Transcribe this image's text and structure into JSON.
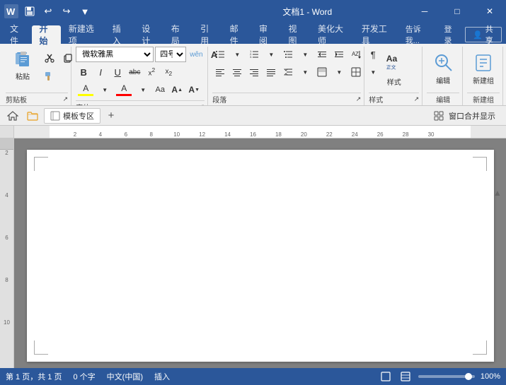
{
  "titlebar": {
    "title": "文档1 - Word",
    "app_name": "Word",
    "doc_name": "文档1",
    "icon": "W",
    "quick_access": {
      "save": "💾",
      "undo": "↩",
      "redo": "↪",
      "dropdown": "▼"
    },
    "controls": {
      "minimize": "─",
      "restore": "□",
      "close": "✕"
    }
  },
  "tabs": {
    "items": [
      "文件",
      "开始",
      "新建选项",
      "插入",
      "设计",
      "布局",
      "引用",
      "邮件",
      "审阅",
      "视图",
      "美化大师",
      "开发工具"
    ],
    "active": "开始",
    "right_items": [
      "告诉我...",
      "登录"
    ],
    "share_label": "共享"
  },
  "ribbon": {
    "clipboard_group": {
      "label": "剪贴板",
      "paste_label": "粘贴",
      "cut_label": "剪切",
      "copy_label": "复制",
      "format_painter_label": "格式刷"
    },
    "font_group": {
      "label": "字体",
      "font_name": "微软雅黑",
      "font_size": "四号",
      "wn_label": "wên",
      "a_label": "A",
      "bold": "B",
      "italic": "I",
      "underline": "U",
      "strikethrough": "abc",
      "superscript": "x²",
      "subscript": "x₂",
      "clear_format": "A",
      "text_highlight": "A",
      "font_color": "A",
      "font_case": "Aa",
      "grow": "A↑",
      "shrink": "A↓",
      "change_case": "A"
    },
    "paragraph_group": {
      "label": "段落",
      "bullets": "≡",
      "numbering": "≡#",
      "multilevel": "≡⋮",
      "decrease_indent": "←≡",
      "increase_indent": "→≡",
      "sort": "↕A",
      "show_marks": "¶",
      "align_left": "≡←",
      "center": "≡|",
      "align_right": "≡→",
      "justify": "≡≡",
      "line_spacing": "≡↕",
      "shading": "◻",
      "borders": "⊟"
    },
    "style_group": {
      "label": "样式",
      "style_btn": "样式"
    },
    "editing_group": {
      "label": "编辑",
      "edit_btn": "编辑"
    },
    "new_group": {
      "label": "新建组",
      "new_btn": "新建组"
    }
  },
  "toolbar": {
    "home_icon": "🏠",
    "folder_icon": "📁",
    "template_label": "模板专区",
    "add_icon": "+",
    "window_merge": "窗口合并显示"
  },
  "ruler": {
    "marks": [
      2,
      4,
      6,
      8,
      10,
      12,
      14,
      16,
      18,
      20,
      22,
      24,
      26,
      28,
      30
    ]
  },
  "status_bar": {
    "page_info": "第 1 页，共 1 页",
    "word_count": "0 个字",
    "language": "中文(中国)",
    "mode": "插入",
    "zoom": "100%",
    "layout_icon": "📄",
    "web_icon": "🌐",
    "read_icon": "📖"
  },
  "page": {
    "content": ""
  }
}
